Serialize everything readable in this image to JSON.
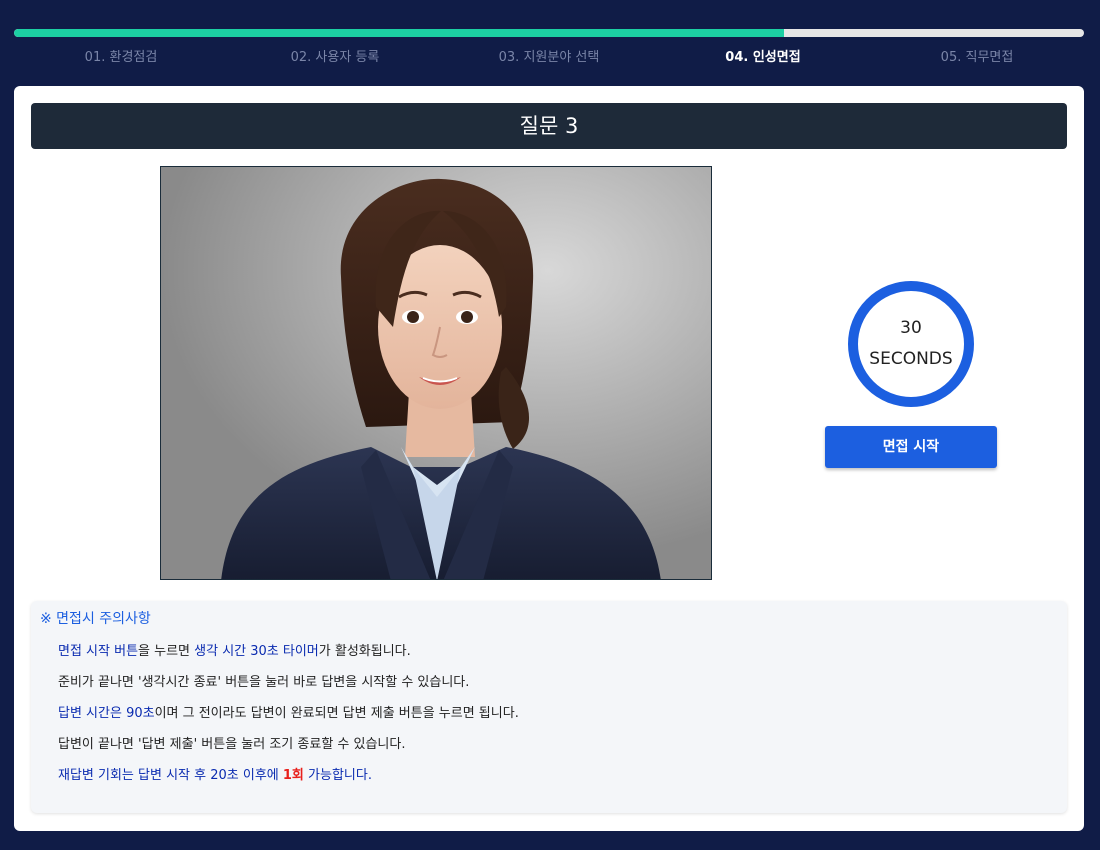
{
  "progress": {
    "fraction": 0.72
  },
  "steps": [
    {
      "label": "01. 환경점검",
      "active": false
    },
    {
      "label": "02. 사용자 등록",
      "active": false
    },
    {
      "label": "03. 지원분야 선택",
      "active": false
    },
    {
      "label": "04. 인성면접",
      "active": true
    },
    {
      "label": "05. 직무면접",
      "active": false
    }
  ],
  "question": {
    "title": "질문 3"
  },
  "timer": {
    "value": "30",
    "unit": "SECONDS"
  },
  "start_button": {
    "label": "면접 시작"
  },
  "notes": {
    "title": "※ 면접시 주의사항",
    "line1": {
      "a": "면접 시작 버튼",
      "b": "을 누르면 ",
      "c": "생각 시간 30초 타이머",
      "d": "가 활성화됩니다."
    },
    "line2": "준비가 끝나면 '생각시간 종료' 버튼을 눌러 바로 답변을 시작할 수 있습니다.",
    "line3": {
      "a": "답변 시간은 90초",
      "b": "이며 그 전이라도 답변이 완료되면 답변 제출 버튼을 누르면 됩니다."
    },
    "line4": "답변이 끝나면 '답변 제출' 버튼을 눌러 조기 종료할 수 있습니다.",
    "line5": {
      "a": "재답변 기회는 답변 시작 후 20초 이후에 ",
      "b": "1회",
      "c": " 가능합니다."
    }
  },
  "colors": {
    "background": "#101c47",
    "progress": "#1ccfa3",
    "accent": "#1c5fe0",
    "question_bar": "#1e2a39",
    "highlight": "#0a2bb0",
    "warning": "#e8201c"
  }
}
